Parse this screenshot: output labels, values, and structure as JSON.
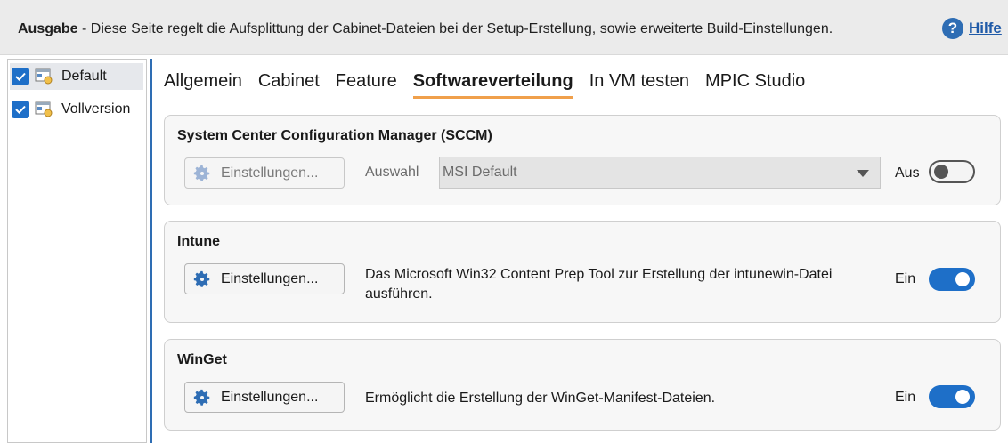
{
  "header": {
    "label": "Ausgabe",
    "description": " - Diese Seite regelt die Aufsplittung der Cabinet-Dateien bei der Setup-Erstellung, sowie erweiterte Build-Einstellungen.",
    "help_label": "Hilfe",
    "help_icon": "question-circle-icon"
  },
  "sidebar": {
    "items": [
      {
        "label": "Default",
        "checked": true,
        "selected": true
      },
      {
        "label": "Vollversion",
        "checked": true,
        "selected": false
      }
    ]
  },
  "tabs": [
    {
      "label": "Allgemein",
      "active": false
    },
    {
      "label": "Cabinet",
      "active": false
    },
    {
      "label": "Feature",
      "active": false
    },
    {
      "label": "Softwareverteilung",
      "active": true
    },
    {
      "label": "In VM testen",
      "active": false
    },
    {
      "label": "MPIC Studio",
      "active": false
    }
  ],
  "sccm": {
    "title": "System Center Configuration Manager (SCCM)",
    "button_label": "Einstellungen...",
    "selection_label": "Auswahl",
    "selection_value": "MSI Default",
    "toggle_label": "Aus",
    "toggle_on": false
  },
  "intune": {
    "title": "Intune",
    "button_label": "Einstellungen...",
    "description": "Das Microsoft Win32 Content Prep Tool zur Erstellung der intunewin-Datei ausführen.",
    "toggle_label": "Ein",
    "toggle_on": true
  },
  "winget": {
    "title": "WinGet",
    "button_label": "Einstellungen...",
    "description": "Ermöglicht die Erstellung der WinGet-Manifest-Dateien.",
    "toggle_label": "Ein",
    "toggle_on": true
  },
  "colors": {
    "accent": "#1e6fc8",
    "tab_underline": "#f0a04b",
    "sidebar_separator": "#2e6db4"
  }
}
